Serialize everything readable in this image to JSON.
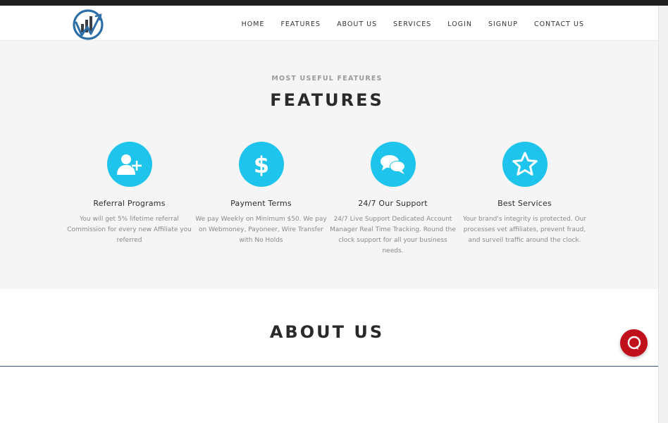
{
  "nav": {
    "items": [
      {
        "label": "HOME"
      },
      {
        "label": "FEATURES"
      },
      {
        "label": "ABOUT US"
      },
      {
        "label": "SERVICES"
      },
      {
        "label": "LOGIN"
      },
      {
        "label": "SIGNUP"
      },
      {
        "label": "CONTACT US"
      }
    ]
  },
  "features": {
    "eyebrow": "MOST USEFUL FEATURES",
    "title": "FEATURES",
    "cards": [
      {
        "icon": "user-plus-icon",
        "title": "Referral Programs",
        "text": "You will get 5% lifetime referral Commission for every new Affiliate you referred"
      },
      {
        "icon": "dollar-icon",
        "title": "Payment Terms",
        "text": "We pay Weekly on Minimum $50. We pay on Webmoney, Payoneer, Wire Transfer with No Holds"
      },
      {
        "icon": "chat-bubbles-icon",
        "title": "24/7 Our Support",
        "text": "24/7 Live Support Dedicated Account Manager Real Time Tracking. Round the clock support for all your business needs."
      },
      {
        "icon": "star-icon",
        "title": "Best Services",
        "text": "Your brand's integrity is protected. Our processes vet affiliates, prevent fraud, and surveil traffic around the clock."
      }
    ]
  },
  "about": {
    "title": "ABOUT US"
  },
  "colors": {
    "accent": "#1ec4ec",
    "logo_blue": "#2f6fa8",
    "chat_red": "#c0101c",
    "section_bg": "#f4f5f4"
  },
  "icons": {
    "logo": "chart-logo-icon",
    "chat": "chat-widget-icon"
  }
}
